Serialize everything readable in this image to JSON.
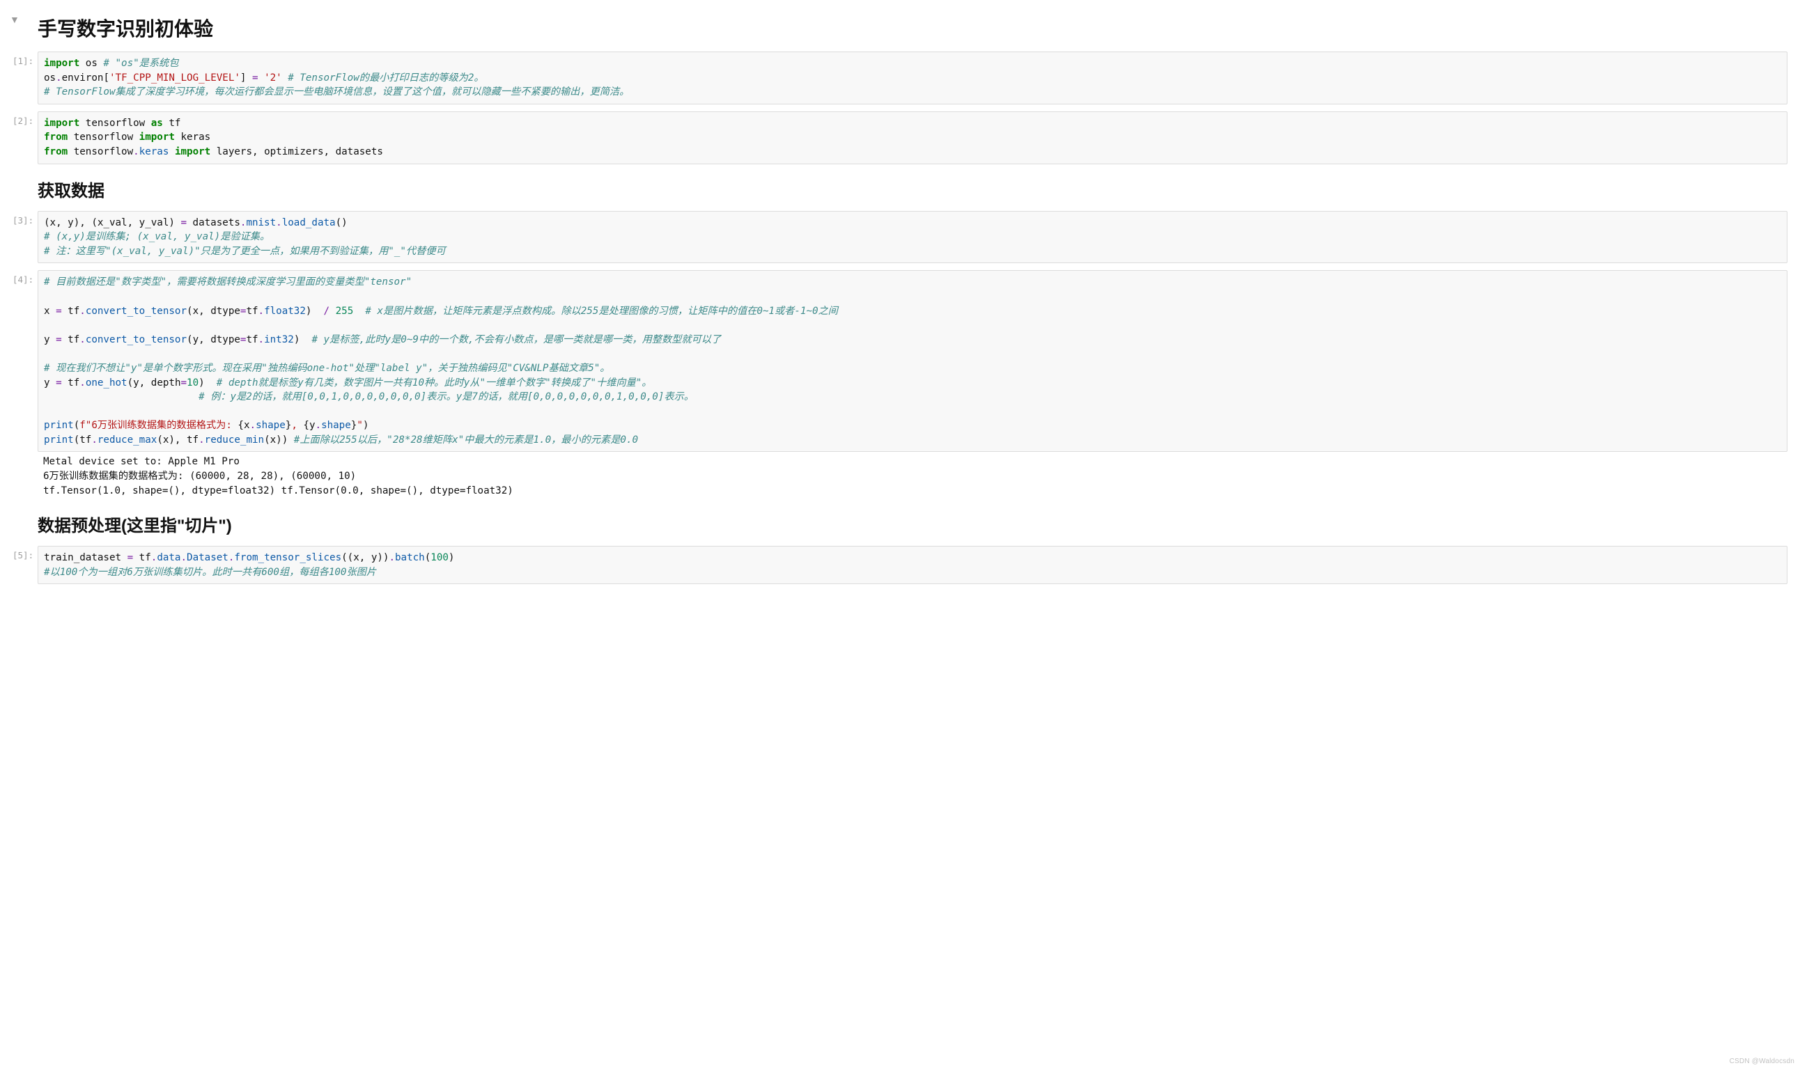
{
  "collapse_glyph": "▼",
  "title_h1": "手写数字识别初体验",
  "title_h2_data": "获取数据",
  "title_h2_preprocess": "数据预处理(这里指\"切片\")",
  "prompts": {
    "c1": "[1]:",
    "c2": "[2]:",
    "c3": "[3]:",
    "c4": "[4]:",
    "c5": "[5]:"
  },
  "watermark": "CSDN @Waldocsdn",
  "code1": {
    "l1a": "import",
    "l1b": " os ",
    "l1c": "# \"os\"是系统包",
    "l2a": "os",
    "l2b": ".",
    "l2c": "environ",
    "l2d": "[",
    "l2e": "'TF_CPP_MIN_LOG_LEVEL'",
    "l2f": "] ",
    "l2g": "=",
    "l2h": " ",
    "l2i": "'2'",
    "l2j": " ",
    "l2k": "# TensorFlow的最小打印日志的等级为2。",
    "l3": "# TensorFlow集成了深度学习环境，每次运行都会显示一些电脑环境信息，设置了这个值，就可以隐藏一些不紧要的输出，更简洁。"
  },
  "code2": {
    "l1a": "import",
    "l1b": " tensorflow ",
    "l1c": "as",
    "l1d": " tf",
    "l2a": "from",
    "l2b": " tensorflow ",
    "l2c": "import",
    "l2d": " keras",
    "l3a": "from",
    "l3b": " tensorflow",
    "l3c": ".",
    "l3d": "keras",
    "l3e": " ",
    "l3f": "import",
    "l3g": " layers, optimizers, datasets"
  },
  "code3": {
    "l1a": "(x, y), (x_val, y_val) ",
    "l1b": "=",
    "l1c": " datasets",
    "l1d": ".",
    "l1e": "mnist",
    "l1f": ".",
    "l1g": "load_data",
    "l1h": "()",
    "l2": "# (x,y)是训练集; (x_val, y_val)是验证集。",
    "l3": "# 注：这里写\"(x_val, y_val)\"只是为了更全一点，如果用不到验证集，用\"_\"代替便可"
  },
  "code4": {
    "l1": "# 目前数据还是\"数字类型\"，需要将数据转换成深度学习里面的变量类型\"tensor\"",
    "l3a": "x ",
    "l3b": "=",
    "l3c": " tf",
    "l3d": ".",
    "l3e": "convert_to_tensor",
    "l3f": "(x, dtype",
    "l3g": "=",
    "l3h": "tf",
    "l3i": ".",
    "l3j": "float32",
    "l3k": ")  ",
    "l3l": "/",
    "l3m": " ",
    "l3n": "255",
    "l3o": "  ",
    "l3p": "# x是图片数据，让矩阵元素是浮点数构成。除以255是处理图像的习惯，让矩阵中的值在0~1或者-1~0之间",
    "l5a": "y ",
    "l5b": "=",
    "l5c": " tf",
    "l5d": ".",
    "l5e": "convert_to_tensor",
    "l5f": "(y, dtype",
    "l5g": "=",
    "l5h": "tf",
    "l5i": ".",
    "l5j": "int32",
    "l5k": ")  ",
    "l5l": "# y是标签,此时y是0~9中的一个数,不会有小数点，是哪一类就是哪一类，用整数型就可以了",
    "l7": "# 现在我们不想让\"y\"是单个数字形式。现在采用\"独热编码one-hot\"处理\"label y\"，关于独热编码见\"CV&NLP基础文章5\"。",
    "l8a": "y ",
    "l8b": "=",
    "l8c": " tf",
    "l8d": ".",
    "l8e": "one_hot",
    "l8f": "(y, depth",
    "l8g": "=",
    "l8h": "10",
    "l8i": ")  ",
    "l8j": "# depth就是标签y有几类，数字图片一共有10种。此时y从\"一维单个数字\"转换成了\"十维向量\"。",
    "l9a": "                          ",
    "l9b": "# 例：y是2的话，就用[0,0,1,0,0,0,0,0,0,0]表示。y是7的话，就用[0,0,0,0,0,0,0,1,0,0,0]表示。",
    "l11a": "print",
    "l11b": "(",
    "l11c": "f\"6万张训练数据集的数据格式为: ",
    "l11d": "{",
    "l11e": "x",
    "l11f": ".",
    "l11g": "shape",
    "l11h": "}",
    "l11i": ", ",
    "l11j": "{",
    "l11k": "y",
    "l11l": ".",
    "l11m": "shape",
    "l11n": "}",
    "l11o": "\"",
    "l11p": ")",
    "l12a": "print",
    "l12b": "(tf",
    "l12c": ".",
    "l12d": "reduce_max",
    "l12e": "(x), tf",
    "l12f": ".",
    "l12g": "reduce_min",
    "l12h": "(x)) ",
    "l12i": "#上面除以255以后，\"28*28维矩阵x\"中最大的元素是1.0，最小的元素是0.0"
  },
  "out4": "Metal device set to: Apple M1 Pro\n6万张训练数据集的数据格式为: (60000, 28, 28), (60000, 10)\ntf.Tensor(1.0, shape=(), dtype=float32) tf.Tensor(0.0, shape=(), dtype=float32)",
  "code5": {
    "l1a": "train_dataset ",
    "l1b": "=",
    "l1c": " tf",
    "l1d": ".",
    "l1e": "data",
    "l1f": ".",
    "l1g": "Dataset",
    "l1h": ".",
    "l1i": "from_tensor_slices",
    "l1j": "((x, y))",
    "l1k": ".",
    "l1l": "batch",
    "l1m": "(",
    "l1n": "100",
    "l1o": ")",
    "l2": "#以100个为一组对6万张训练集切片。此时一共有600组，每组各100张图片"
  }
}
